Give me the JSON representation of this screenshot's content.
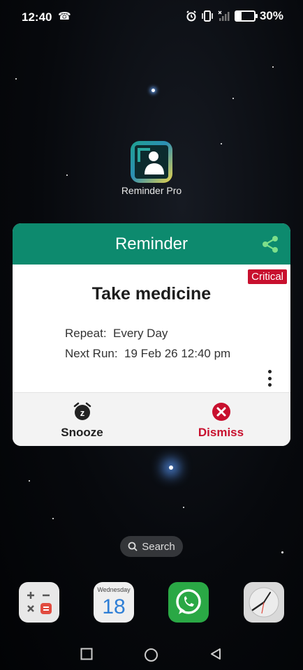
{
  "status_bar": {
    "time": "12:40",
    "battery_percent": "30%",
    "icons": [
      "phone-call-icon",
      "alarm-icon",
      "vibrate-icon",
      "no-signal-icon",
      "battery-charging-icon"
    ]
  },
  "home_app": {
    "label": "Reminder Pro"
  },
  "reminder_card": {
    "header_title": "Reminder",
    "priority_badge": "Critical",
    "task_title": "Take medicine",
    "repeat_label": "Repeat:",
    "repeat_value": "Every Day",
    "next_run_label": "Next Run:",
    "next_run_value": "19 Feb 26  12:40 pm",
    "snooze_label": "Snooze",
    "dismiss_label": "Dismiss",
    "colors": {
      "header": "#0d8a6e",
      "badge": "#c8102e",
      "dismiss": "#c8102e"
    }
  },
  "search": {
    "label": "Search"
  },
  "dock": {
    "calendar_weekday": "Wednesday",
    "calendar_day": "18",
    "apps": [
      "calculator-icon",
      "calendar-icon",
      "whatsapp-icon",
      "clock-icon"
    ]
  },
  "nav_bar": {
    "buttons": [
      "recents-icon",
      "home-icon",
      "back-icon"
    ]
  }
}
